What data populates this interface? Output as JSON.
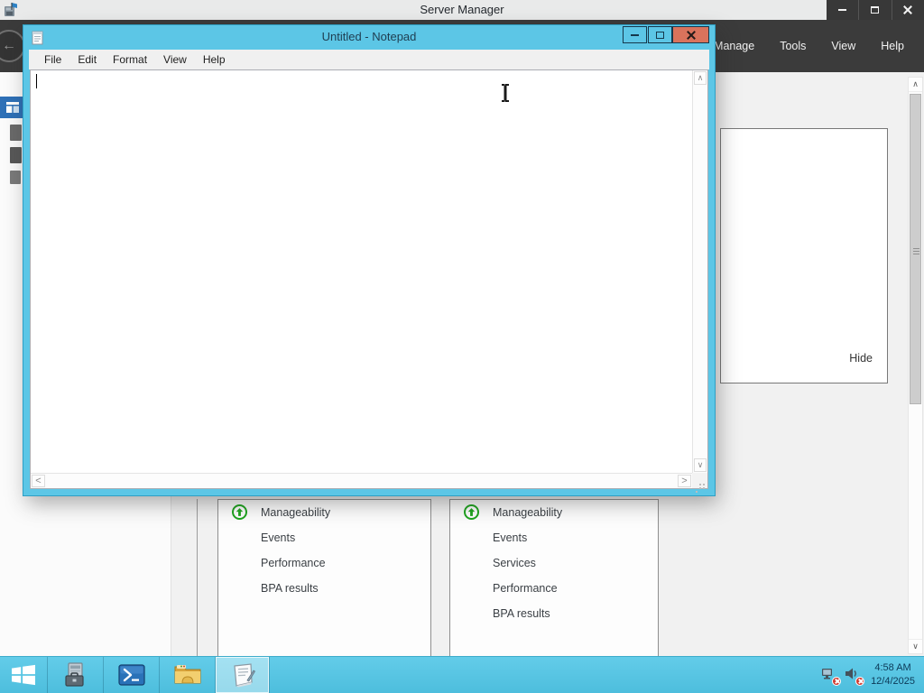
{
  "server_manager": {
    "title": "Server Manager",
    "menu": [
      {
        "label": "Manage"
      },
      {
        "label": "Tools"
      },
      {
        "label": "View"
      },
      {
        "label": "Help"
      }
    ],
    "flyout": {
      "hide_label": "Hide"
    },
    "scrollbar": {
      "up_glyph": "∧",
      "down_glyph": "∨"
    },
    "dashboard": {
      "tile_left": {
        "rows": [
          {
            "label": "Manageability",
            "icon": "status-up-arrow"
          },
          {
            "label": "Events",
            "icon": ""
          },
          {
            "label": "Performance",
            "icon": ""
          },
          {
            "label": "BPA results",
            "icon": ""
          }
        ]
      },
      "tile_right": {
        "rows": [
          {
            "label": "Manageability",
            "icon": "status-up-arrow"
          },
          {
            "label": "Events",
            "icon": ""
          },
          {
            "label": "Services",
            "icon": ""
          },
          {
            "label": "Performance",
            "icon": ""
          },
          {
            "label": "BPA results",
            "icon": ""
          }
        ]
      }
    }
  },
  "notepad": {
    "title": "Untitled - Notepad",
    "menu": [
      {
        "label": "File"
      },
      {
        "label": "Edit"
      },
      {
        "label": "Format"
      },
      {
        "label": "View"
      },
      {
        "label": "Help"
      }
    ],
    "text_value": "",
    "scrollbar": {
      "up_glyph": "∧",
      "down_glyph": "∨",
      "left_glyph": "<",
      "right_glyph": ">"
    }
  },
  "taskbar": {
    "clock": {
      "time": "4:58 AM",
      "date": "12/4/2025"
    }
  },
  "colors": {
    "accent_cyan": "#57C4E3",
    "dark_bar": "#3B3B3B",
    "selected_blue": "#2E70B7",
    "status_green": "#1FA51F",
    "close_red": "#D9735C"
  }
}
